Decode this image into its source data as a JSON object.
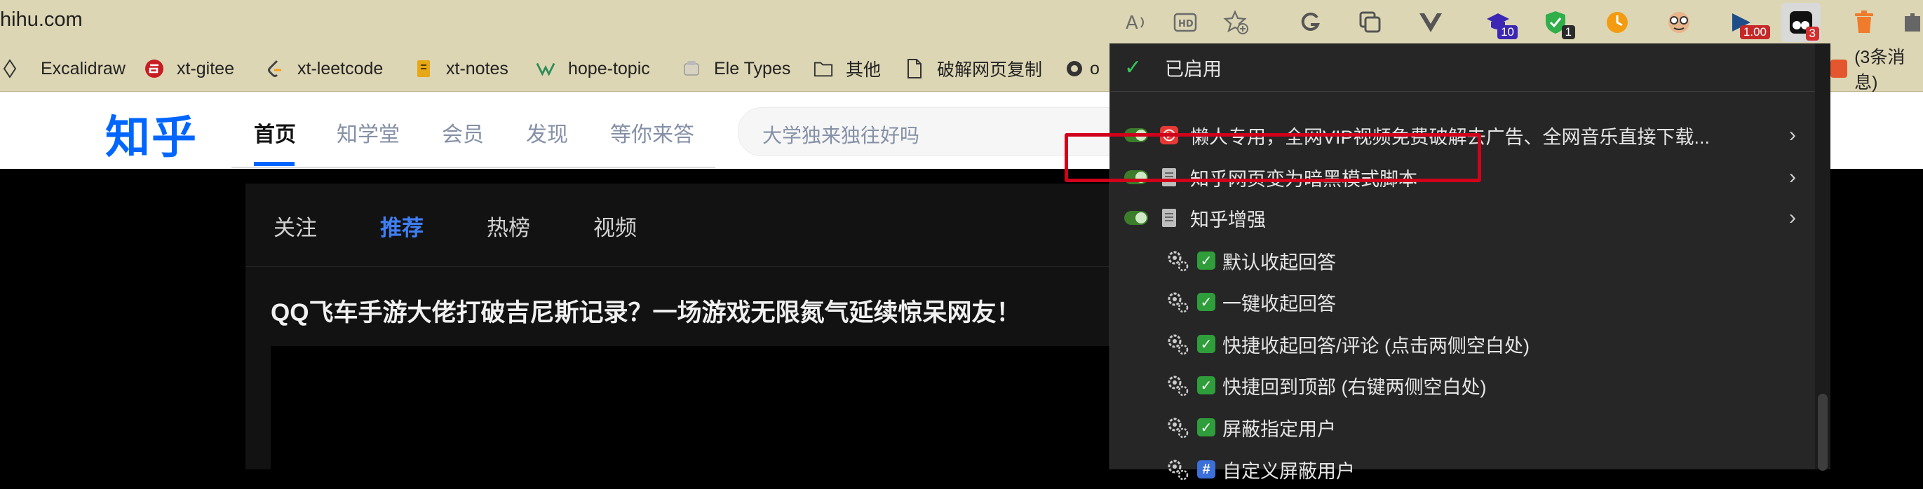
{
  "browser": {
    "url": "hihu.com",
    "toolbar": {
      "read_aloud_icon": "read-aloud-icon",
      "hd_icon": "hd-icon",
      "add_favorite_icon": "add-favorite-icon",
      "extensions": [
        {
          "name": "grammarly-icon"
        },
        {
          "name": "collections-icon"
        },
        {
          "name": "vue-devtools-icon"
        },
        {
          "name": "grad-cap-extension-icon",
          "badge": "10",
          "badge_color": "#3b27b3"
        },
        {
          "name": "shield-check-extension-icon",
          "badge": "1",
          "badge_color": "#2a2a2a"
        },
        {
          "name": "clock-extension-icon"
        },
        {
          "name": "face-extension-icon"
        },
        {
          "name": "play-extension-icon",
          "badge": "1.00",
          "badge_color": "#c62828"
        },
        {
          "name": "tampermonkey-icon",
          "badge": "3",
          "badge_color": "#d32f2f"
        },
        {
          "name": "trash-extension-icon"
        },
        {
          "name": "puzzle-extension-icon"
        }
      ]
    },
    "bookmarks": [
      {
        "label": "Excalidraw",
        "icon": "excalidraw-icon"
      },
      {
        "label": "xt-gitee",
        "icon": "gitee-icon"
      },
      {
        "label": "xt-leetcode",
        "icon": "leetcode-icon"
      },
      {
        "label": "xt-notes",
        "icon": "notes-icon"
      },
      {
        "label": "hope-topic",
        "icon": "hope-icon"
      },
      {
        "label": "Ele Types",
        "icon": "ele-icon"
      },
      {
        "label": "其他",
        "icon": "folder-icon"
      },
      {
        "label": "破解网页复制",
        "icon": "page-icon"
      },
      {
        "label": "o",
        "icon": "o-icon"
      }
    ],
    "right_tab": "(3条消息)"
  },
  "zhihu": {
    "logo": "知乎",
    "nav": [
      "首页",
      "知学堂",
      "会员",
      "发现",
      "等你来答"
    ],
    "search_placeholder": "大学独来独往好吗",
    "feed_tabs": [
      "关注",
      "推荐",
      "热榜",
      "视频"
    ],
    "feed_title": "QQ飞车手游大佬打破吉尼斯记录？一场游戏无限氮气延续惊呆网友！"
  },
  "menu": {
    "enabled_header": "已启用",
    "scripts": [
      {
        "label": "懒人专用，全网VIP视频免费破解去广告、全网音乐直接下载...",
        "icon": "video-script-icon"
      },
      {
        "label": "知乎网页变为暗黑模式脚本",
        "icon": "doc-script-icon"
      },
      {
        "label": "知乎增强",
        "icon": "doc-script-icon"
      }
    ],
    "commands": [
      {
        "label": "默认收起回答",
        "mark": "✓",
        "mark_color": "#2e9d3a"
      },
      {
        "label": "一键收起回答",
        "mark": "✓",
        "mark_color": "#2e9d3a"
      },
      {
        "label": "快捷收起回答/评论 (点击两侧空白处)",
        "mark": "✓",
        "mark_color": "#2e9d3a"
      },
      {
        "label": "快捷回到顶部 (右键两侧空白处)",
        "mark": "✓",
        "mark_color": "#2e9d3a"
      },
      {
        "label": "屏蔽指定用户",
        "mark": "✓",
        "mark_color": "#2e9d3a"
      },
      {
        "label": "自定义屏蔽用户",
        "mark": "#",
        "mark_color": "#3b6fd9"
      }
    ]
  }
}
